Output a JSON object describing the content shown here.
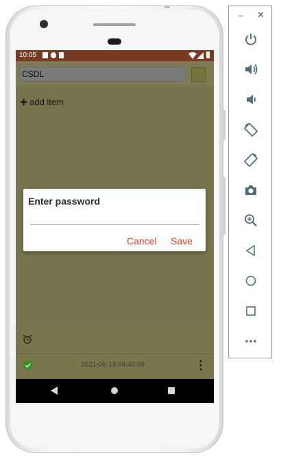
{
  "statusbar": {
    "time": "10:05"
  },
  "app": {
    "title_value": "CSDL",
    "add_item_label": "add item",
    "item_date": "2021-06-13 09:40:59"
  },
  "dialog": {
    "title": "Enter password",
    "password_value": "",
    "cancel_label": "Cancel",
    "save_label": "Save"
  },
  "toolbar": {
    "buttons": [
      "power-icon",
      "volume-up-icon",
      "volume-down-icon",
      "rotate-left-icon",
      "rotate-right-icon",
      "camera-icon",
      "zoom-icon",
      "back-icon",
      "home-icon",
      "overview-icon",
      "more-icon"
    ]
  },
  "colors": {
    "accent": "#d9432c",
    "statusbar": "#7b3b22",
    "scrim": "#77734f"
  }
}
